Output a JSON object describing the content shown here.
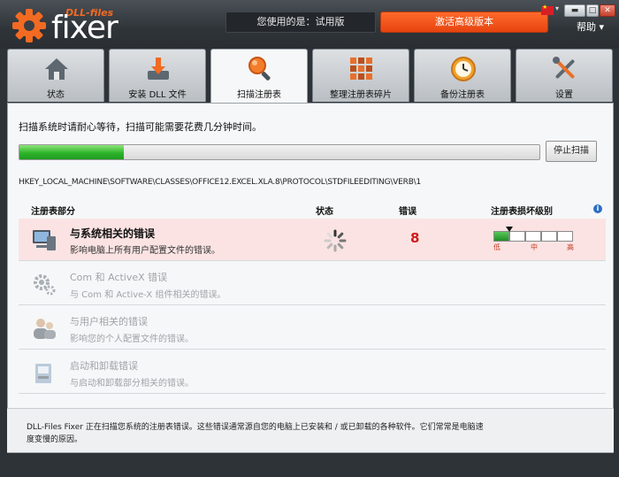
{
  "brand": {
    "tagline": "DLL-files",
    "product": "fixer"
  },
  "header": {
    "version_text": "您使用的是：试用版",
    "activate_label": "激活高级版本",
    "help_label": "帮助 ▾",
    "accent": "#f36a22"
  },
  "tabs": [
    {
      "label": "状态",
      "icon": "home-icon"
    },
    {
      "label": "安装 DLL 文件",
      "icon": "download-icon"
    },
    {
      "label": "扫描注册表",
      "icon": "magnifier-icon",
      "active": true
    },
    {
      "label": "整理注册表碎片",
      "icon": "defrag-blocks-icon"
    },
    {
      "label": "备份注册表",
      "icon": "backup-clock-icon"
    },
    {
      "label": "设置",
      "icon": "tools-icon"
    }
  ],
  "scan": {
    "instruction": "扫描系统时请耐心等待，扫描可能需要花费几分钟时间。",
    "progress": 0.2,
    "stop_label": "停止扫描",
    "current_path": "HKEY_LOCAL_MACHINE\\SOFTWARE\\CLASSES\\OFFICE12.EXCEL.XLA.8\\PROTOCOL\\STDFILEEDITING\\VERB\\1"
  },
  "table": {
    "headers": {
      "section": "注册表部分",
      "status": "状态",
      "errors": "错误",
      "level": "注册表损坏级别"
    },
    "rows": [
      {
        "title": "与系统相关的错误",
        "desc": "影响电脑上所有用户配置文件的错误。",
        "errors": "8",
        "active": true,
        "level": 0.2
      },
      {
        "title": "Com 和 ActiveX 错误",
        "desc": "与 Com 和 Active-X 组件相关的错误。"
      },
      {
        "title": "与用户相关的错误",
        "desc": "影响您的个人配置文件的错误。"
      },
      {
        "title": "启动和卸载错误",
        "desc": "与启动和卸载部分相关的错误。"
      }
    ],
    "level_labels": {
      "low": "低",
      "mid": "中",
      "high": "高"
    }
  },
  "footer": {
    "text": "DLL-Files Fixer 正在扫描您系统的注册表错误。这些错误通常源自您的电脑上已安装和 / 或已卸载的各种软件。它们常常是电脑速度变慢的原因。"
  }
}
